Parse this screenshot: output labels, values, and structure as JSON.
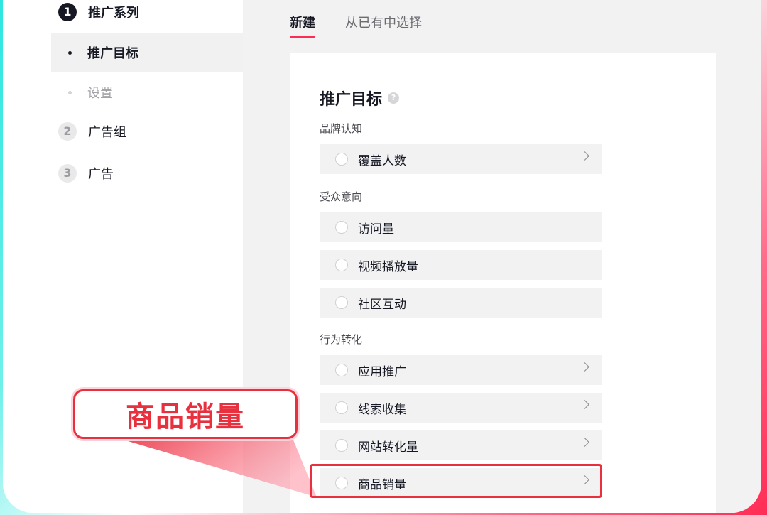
{
  "sidebar": {
    "steps": [
      {
        "num": "1",
        "label": "推广系列"
      },
      {
        "num": "2",
        "label": "广告组"
      },
      {
        "num": "3",
        "label": "广告"
      }
    ],
    "sub_items": [
      {
        "label": "推广目标",
        "state": "active"
      },
      {
        "label": "设置",
        "state": "inactive"
      }
    ]
  },
  "tabs": [
    {
      "label": "新建",
      "state": "active"
    },
    {
      "label": "从已有中选择",
      "state": "inactive"
    }
  ],
  "card": {
    "title": "推广目标",
    "help_icon": "?",
    "sections": [
      {
        "label": "品牌认知",
        "options": [
          {
            "label": "覆盖人数",
            "has_chevron": true
          }
        ]
      },
      {
        "label": "受众意向",
        "options": [
          {
            "label": "访问量",
            "has_chevron": false
          },
          {
            "label": "视频播放量",
            "has_chevron": false
          },
          {
            "label": "社区互动",
            "has_chevron": false
          }
        ]
      },
      {
        "label": "行为转化",
        "options": [
          {
            "label": "应用推广",
            "has_chevron": true
          },
          {
            "label": "线索收集",
            "has_chevron": true
          },
          {
            "label": "网站转化量",
            "has_chevron": true
          },
          {
            "label": "商品销量",
            "has_chevron": true
          }
        ]
      }
    ]
  },
  "callout": {
    "text": "商品销量"
  },
  "colors": {
    "accent": "#fe2c55",
    "callout_red": "#e8303e",
    "frame_cyan": "#2ee6e0"
  }
}
